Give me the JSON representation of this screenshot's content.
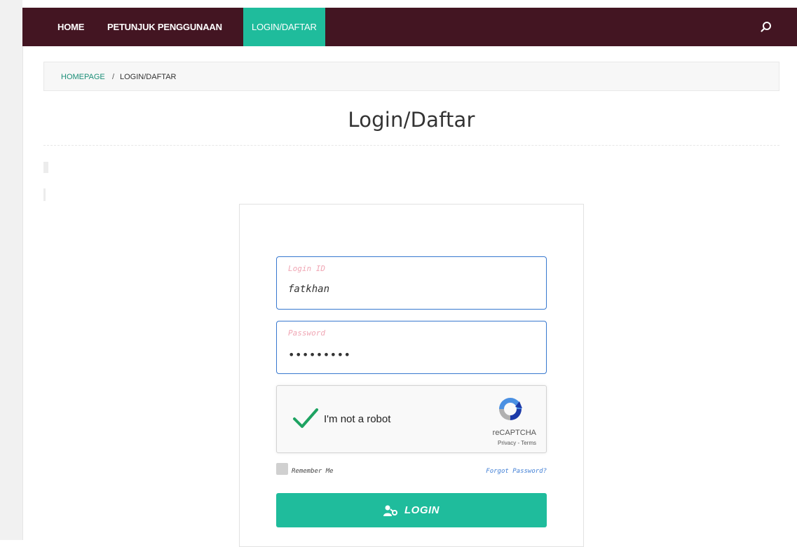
{
  "nav": {
    "items": [
      {
        "label": "HOME"
      },
      {
        "label": "PETUNJUK PENGGUNAAN"
      },
      {
        "label": "LOGIN/DAFTAR"
      }
    ]
  },
  "breadcrumb": {
    "home": "HOMEPAGE",
    "separator": "/",
    "current": "LOGIN/DAFTAR"
  },
  "page": {
    "title": "Login/Daftar"
  },
  "form": {
    "login_id": {
      "label": "Login ID",
      "value": "fatkhan"
    },
    "password": {
      "label": "Password",
      "masked": "•••••••••"
    },
    "recaptcha": {
      "label": "I'm not a robot",
      "brand": "reCAPTCHA",
      "terms": "Privacy - Terms",
      "checked": true
    },
    "remember_label": "Remember Me",
    "forgot_label": "Forgot Password?",
    "login_label": "LOGIN"
  },
  "colors": {
    "navbar": "#431522",
    "accent": "#1fbc9c",
    "input_border": "#3778cf",
    "check": "#1ea362",
    "link": "#3f7ed5"
  }
}
